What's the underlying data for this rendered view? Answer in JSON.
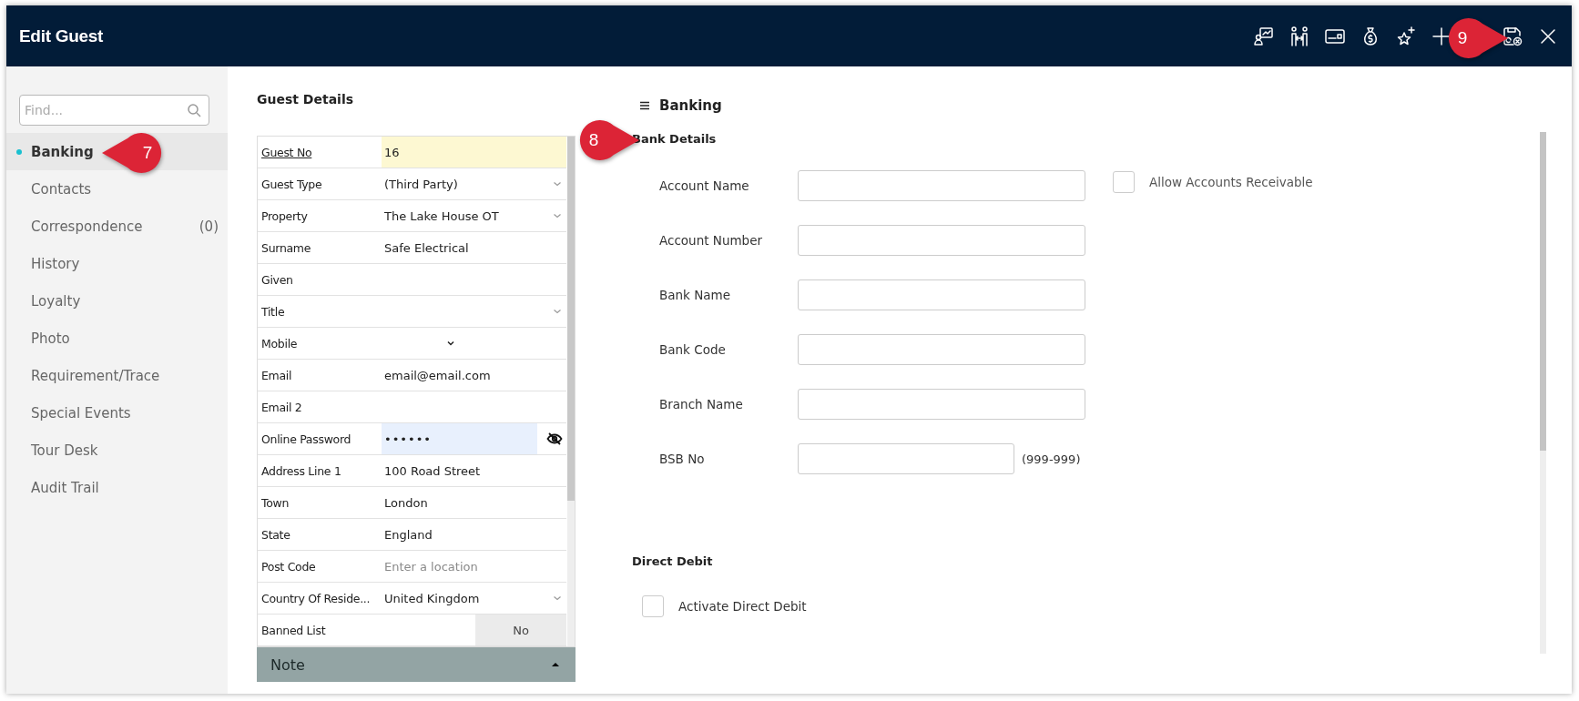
{
  "window": {
    "title": "Edit Guest"
  },
  "sidebar": {
    "search": {
      "placeholder": "Find..."
    },
    "items": [
      {
        "label": "Banking",
        "selected": true
      },
      {
        "label": "Contacts",
        "selected": false
      },
      {
        "label": "Correspondence",
        "count": "(0)",
        "selected": false
      },
      {
        "label": "History",
        "selected": false
      },
      {
        "label": "Loyalty",
        "selected": false
      },
      {
        "label": "Photo",
        "selected": false
      },
      {
        "label": "Requirement/Trace",
        "selected": false
      },
      {
        "label": "Special Events",
        "selected": false
      },
      {
        "label": "Tour Desk",
        "selected": false
      },
      {
        "label": "Audit Trail",
        "selected": false
      }
    ]
  },
  "guest_details": {
    "title": "Guest Details",
    "rows": [
      {
        "label": "Guest No",
        "value": "16",
        "kind": "key"
      },
      {
        "label": "Guest Type",
        "value": "(Third Party)",
        "kind": "select"
      },
      {
        "label": "Property",
        "value": "The Lake House OT",
        "kind": "select"
      },
      {
        "label": "Surname",
        "value": "Safe Electrical",
        "kind": "text"
      },
      {
        "label": "Given",
        "kind": "text"
      },
      {
        "label": "Title",
        "kind": "select"
      },
      {
        "label": "Mobile",
        "kind": "phone"
      },
      {
        "label": "Email",
        "value": "email@email.com",
        "kind": "text"
      },
      {
        "label": "Email 2",
        "kind": "text"
      },
      {
        "label": "Online Password",
        "value": "••••••",
        "kind": "password"
      },
      {
        "label": "Address Line 1",
        "value": "100 Road Street",
        "kind": "text"
      },
      {
        "label": "Town",
        "value": "London",
        "kind": "text"
      },
      {
        "label": "State",
        "value": "England",
        "kind": "text"
      },
      {
        "label": "Post Code",
        "placeholder": "Enter a location",
        "kind": "text"
      },
      {
        "label": "Country Of Reside...",
        "value": "United Kingdom",
        "kind": "select"
      },
      {
        "label": "Banned List",
        "value": "No",
        "kind": "toggle"
      }
    ],
    "note": {
      "label": "Note"
    }
  },
  "banking": {
    "title": "Banking",
    "bank_details": {
      "title": "Bank Details",
      "fields": [
        {
          "label": "Account Name"
        },
        {
          "label": "Account Number"
        },
        {
          "label": "Bank Name"
        },
        {
          "label": "Bank Code"
        },
        {
          "label": "Branch Name"
        },
        {
          "label": "BSB No",
          "hint": "(999-999)"
        }
      ],
      "checkbox": {
        "label": "Allow Accounts Receivable",
        "checked": false
      }
    },
    "direct_debit": {
      "title": "Direct Debit",
      "checkbox": {
        "label": "Activate Direct Debit",
        "checked": false
      }
    }
  },
  "callouts": [
    {
      "label": "7"
    },
    {
      "label": "8"
    },
    {
      "label": "9"
    }
  ]
}
